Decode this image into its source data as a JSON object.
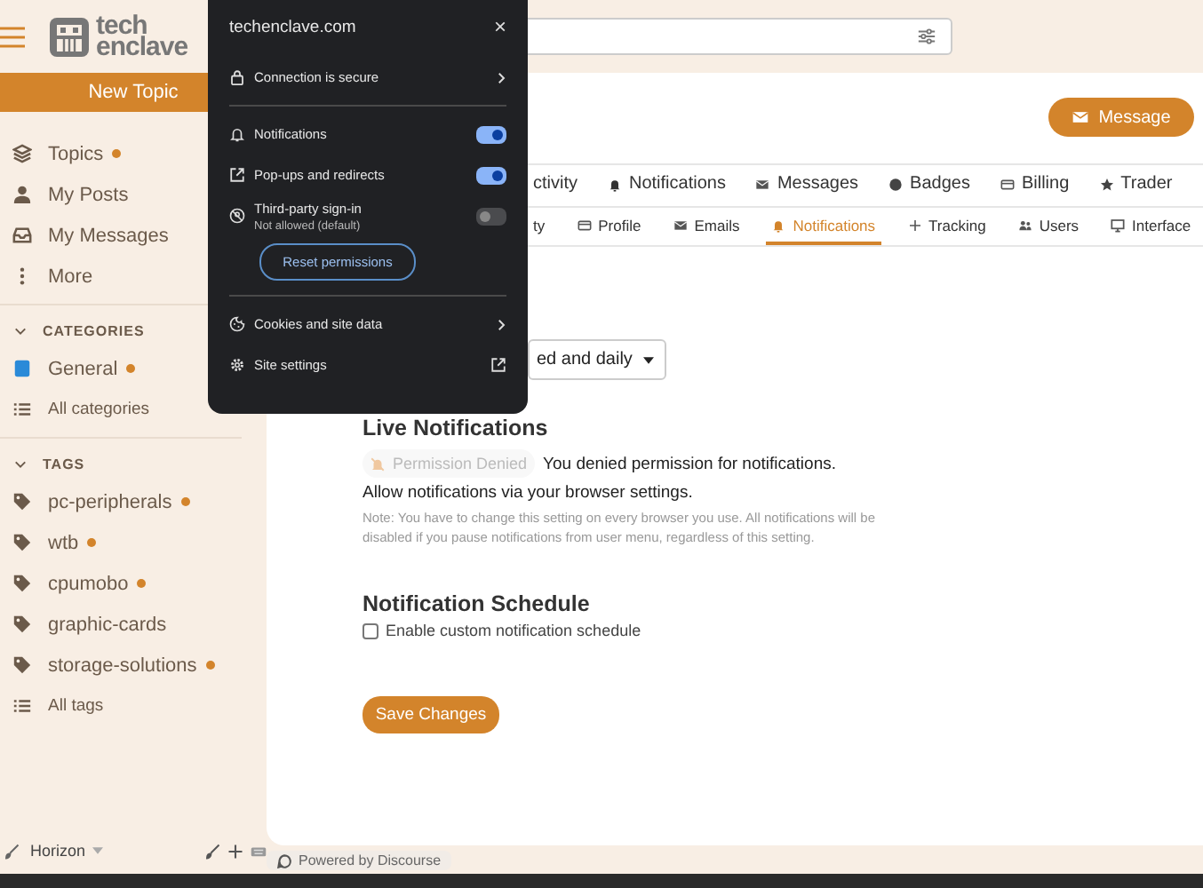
{
  "header": {
    "logo_top": "tech",
    "logo_bottom": "enclave"
  },
  "sidebar": {
    "new_topic": "New Topic",
    "nav": [
      {
        "label": "Topics",
        "has_new": true
      },
      {
        "label": "My Posts",
        "has_new": false
      },
      {
        "label": "My Messages",
        "has_new": false
      },
      {
        "label": "More",
        "has_new": false
      }
    ],
    "categories": {
      "title": "CATEGORIES",
      "expanded": true,
      "items": [
        {
          "kind": "category",
          "label": "General",
          "has_new": true
        },
        {
          "kind": "all",
          "label": "All categories",
          "has_new": false
        }
      ]
    },
    "tags": {
      "title": "TAGS",
      "expanded": true,
      "items": [
        {
          "kind": "tag",
          "label": "pc-peripherals",
          "has_new": true
        },
        {
          "kind": "tag",
          "label": "wtb",
          "has_new": true
        },
        {
          "kind": "tag",
          "label": "cpumobo",
          "has_new": true
        },
        {
          "kind": "tag",
          "label": "graphic-cards",
          "has_new": false
        },
        {
          "kind": "tag",
          "label": "storage-solutions",
          "has_new": true
        },
        {
          "kind": "all",
          "label": "All tags",
          "has_new": false
        }
      ]
    },
    "footer": {
      "theme": "Horizon"
    }
  },
  "popup": {
    "site": "techenclave.com",
    "close": "×",
    "rows": [
      {
        "kind": "link",
        "label": "Connection is secure"
      },
      {
        "kind": "divider"
      },
      {
        "kind": "toggle",
        "label": "Notifications",
        "on": true
      },
      {
        "kind": "toggle",
        "label": "Pop-ups and redirects",
        "on": true
      },
      {
        "kind": "toggle",
        "label": "Third-party sign-in",
        "sublabel": "Not allowed (default)",
        "on": false
      },
      {
        "kind": "button",
        "label": "Reset permissions"
      },
      {
        "kind": "divider"
      },
      {
        "kind": "link",
        "label": "Cookies and site data"
      },
      {
        "kind": "external",
        "label": "Site settings"
      }
    ]
  },
  "main": {
    "message_button": "Message",
    "tabs": [
      {
        "label": "ctivity",
        "selected": false
      },
      {
        "label": "Notifications",
        "selected": false
      },
      {
        "label": "Messages",
        "selected": false
      },
      {
        "label": "Badges",
        "selected": false
      },
      {
        "label": "Billing",
        "selected": false
      },
      {
        "label": "Trader",
        "selected": false
      }
    ],
    "subtabs": [
      {
        "label": "ty",
        "selected": false
      },
      {
        "label": "Profile",
        "selected": false
      },
      {
        "label": "Emails",
        "selected": false
      },
      {
        "label": "Notifications",
        "selected": true
      },
      {
        "label": "Tracking",
        "selected": false
      },
      {
        "label": "Users",
        "selected": false
      },
      {
        "label": "Interface",
        "selected": false
      }
    ],
    "frequency_select": "ed and daily",
    "live_title": "Live Notifications",
    "permission_badge": "Permission Denied",
    "denied_text": "You denied permission for notifications.",
    "allow_text": "Allow notifications via your browser settings.",
    "note": "Note: You have to change this setting on every browser you use. All notifications will be disabled if you pause notifications from user menu, regardless of this setting.",
    "schedule_title": "Notification Schedule",
    "schedule_checkbox": {
      "label": "Enable custom notification schedule",
      "checked": false
    },
    "save_button": "Save Changes",
    "powered_by": "Powered by Discourse"
  }
}
